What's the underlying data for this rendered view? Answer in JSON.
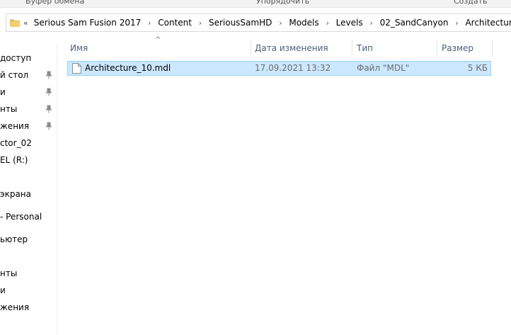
{
  "ribbon": {
    "groups": [
      "Буфер обмена",
      "Упорядочить",
      "Создать"
    ]
  },
  "address": {
    "overflow_label": "«",
    "crumbs": [
      "Serious Sam Fusion 2017",
      "Content",
      "SeriousSamHD",
      "Models",
      "Levels",
      "02_SandCanyon",
      "Architecture"
    ],
    "separator": "›",
    "icon": "folder-icon"
  },
  "nav": {
    "items": [
      {
        "label": "доступ",
        "pinned": false
      },
      {
        "label": "й стол",
        "pinned": true
      },
      {
        "label": "и",
        "pinned": true
      },
      {
        "label": "нты",
        "pinned": true
      },
      {
        "label": "жения",
        "pinned": true
      },
      {
        "label": "ctor_02",
        "pinned": false
      },
      {
        "label": "EL (R:)",
        "pinned": false
      },
      {
        "label": "экрана",
        "pinned": false
      },
      {
        "label": "- Personal",
        "pinned": false
      },
      {
        "label": "ьютер",
        "pinned": false
      },
      {
        "label": "нты",
        "pinned": false
      },
      {
        "label": "и",
        "pinned": false
      },
      {
        "label": "жения",
        "pinned": false
      }
    ]
  },
  "columns": {
    "name": "Имя",
    "date": "Дата изменения",
    "type": "Тип",
    "size": "Размер",
    "sort_indicator": "^"
  },
  "files": [
    {
      "name": "Architecture_10.mdl",
      "date": "17.09.2021 13:32",
      "type": "Файл \"MDL\"",
      "size": "5 КБ",
      "selected": true,
      "icon": "file-icon"
    }
  ],
  "colors": {
    "selection_bg": "#cce8ff",
    "selection_border": "#99d1ff",
    "header_text": "#4c607a",
    "folder": "#dcb45c"
  }
}
